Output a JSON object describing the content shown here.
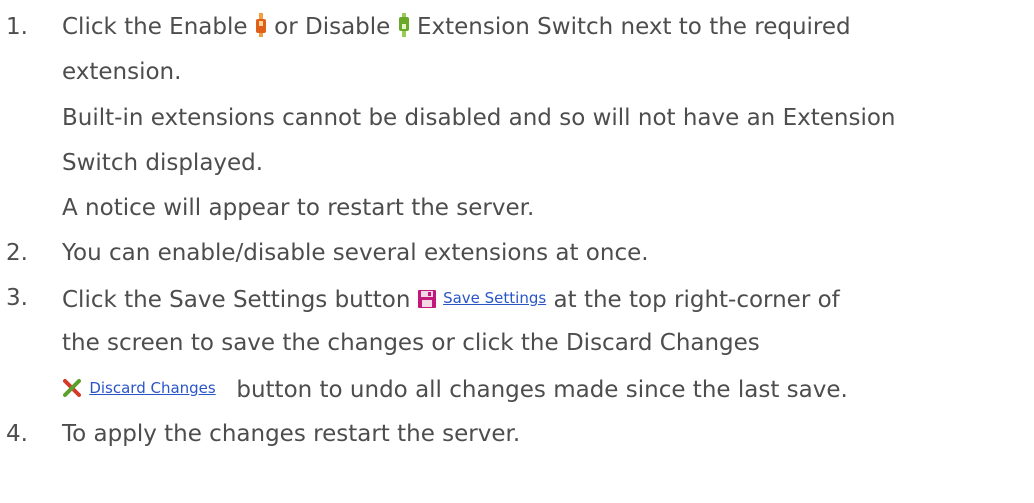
{
  "steps": [
    {
      "number": "1.",
      "text_a": "Click the Enable",
      "text_b": "or Disable",
      "text_c": "Extension Switch next to the required",
      "text_d": "extension.",
      "note_1a": "Built-in extensions cannot be disabled and so will not have an Extension",
      "note_1b": "Switch displayed.",
      "note_2": "A notice will appear to restart the server.",
      "enable_icon": "enable-switch-icon",
      "disable_icon": "disable-switch-icon"
    },
    {
      "number": "2.",
      "text": "You can enable/disable several extensions at once."
    },
    {
      "number": "3.",
      "text_a": "Click the Save Settings button",
      "save_link": "Save Settings",
      "text_b": "at the top right-corner of",
      "text_c": "the screen to save the changes or click the Discard Changes",
      "discard_link": "Discard Changes",
      "text_d": "button to undo all changes made since the last save.",
      "save_icon": "save-icon",
      "discard_icon": "discard-icon"
    },
    {
      "number": "4.",
      "text": "To apply the changes restart the server."
    }
  ],
  "colors": {
    "text": "#4d4d4d",
    "link": "#2a55c8",
    "save_icon": "#c2187a",
    "discard_icon": "#d33a2a",
    "enable_switch": "#e0601a",
    "disable_switch": "#6aa82a"
  }
}
